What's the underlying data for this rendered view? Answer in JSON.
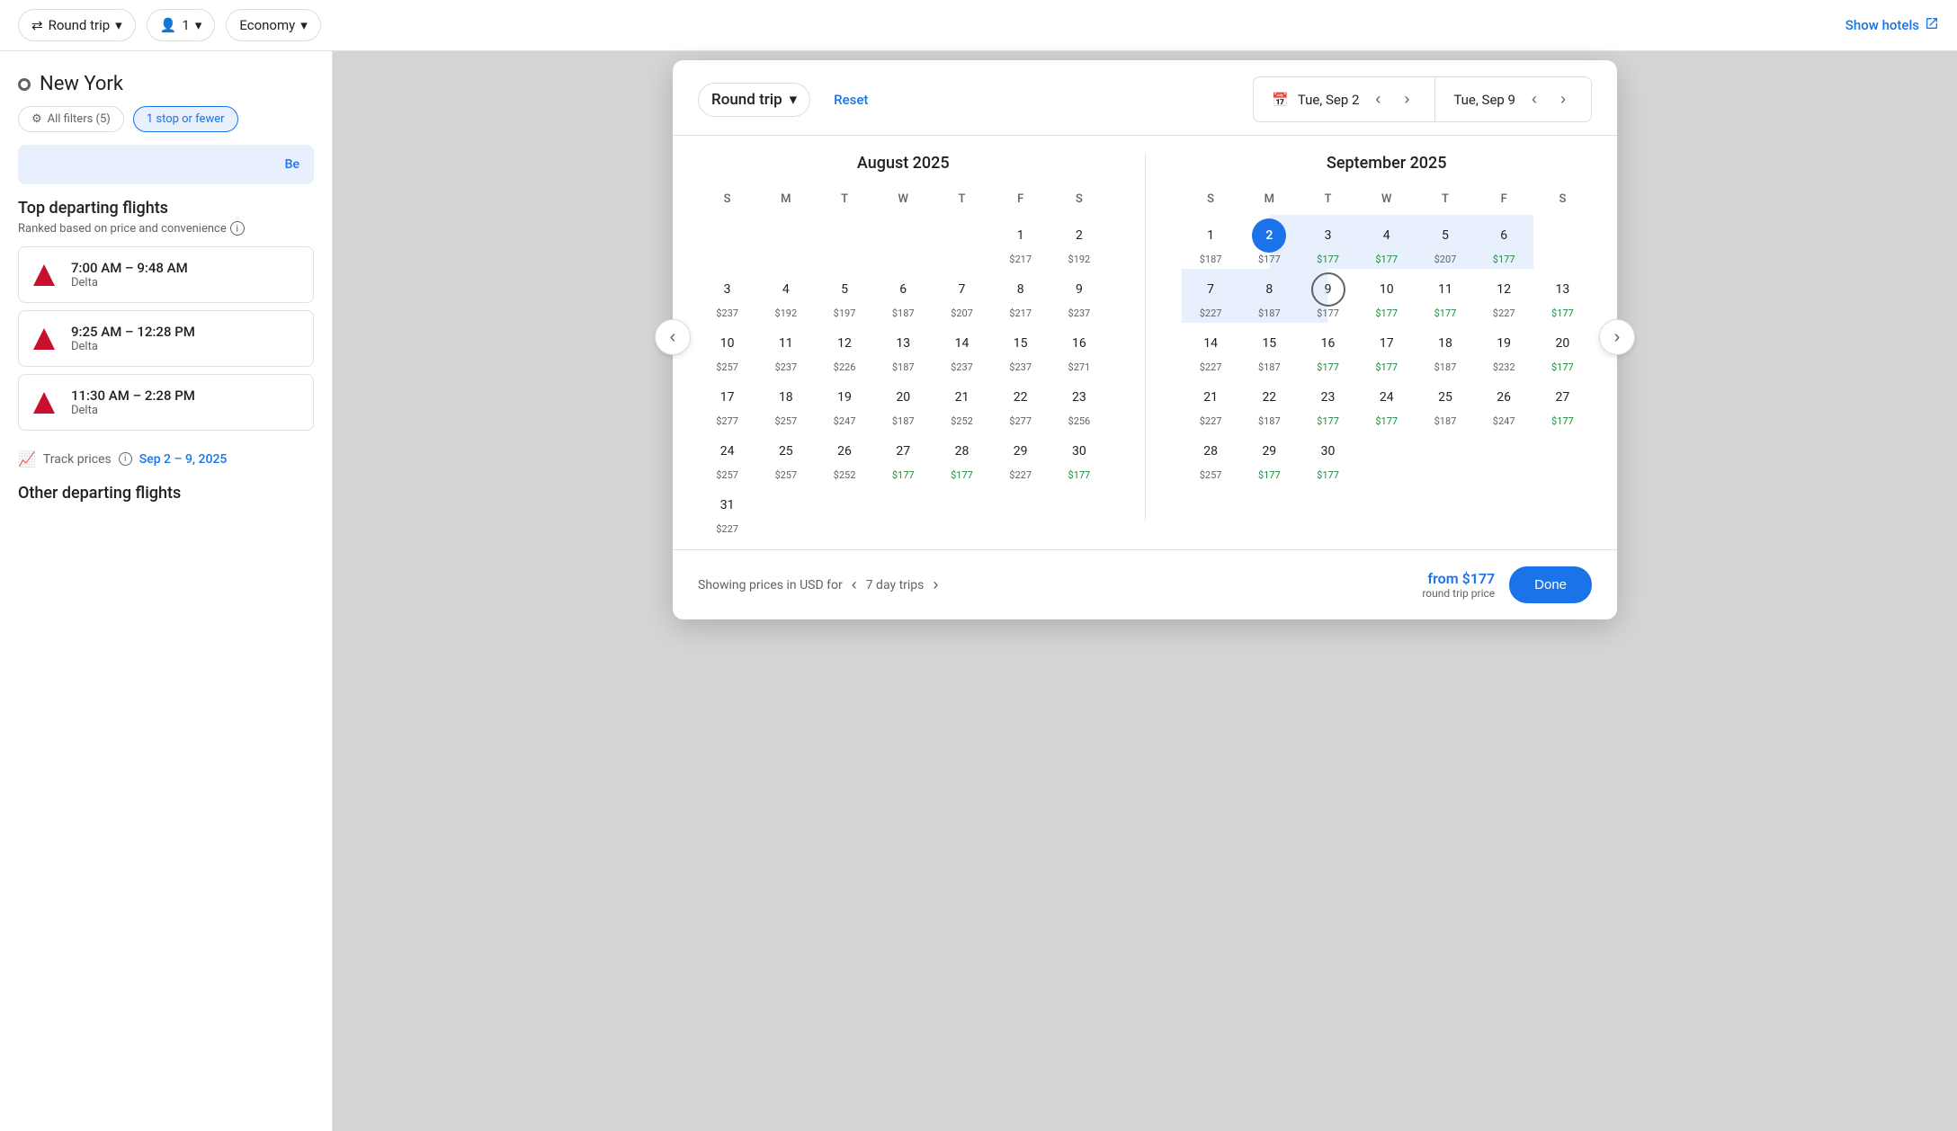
{
  "topBar": {
    "roundTrip": "Round trip",
    "passengers": "1",
    "cabinClass": "Economy",
    "showHotels": "Show hotels"
  },
  "leftPanel": {
    "origin": "New York",
    "filtersLabel": "All filters (5)",
    "stopFilter": "1 stop or fewer",
    "bestLabel": "Be",
    "sectionTitle": "Top departing flights",
    "sectionSub": "Ranked based on price and convenience",
    "flights": [
      {
        "time": "7:00 AM – 9:48 AM",
        "airline": "Delta"
      },
      {
        "time": "9:25 AM – 12:28 PM",
        "airline": "Delta"
      },
      {
        "time": "11:30 AM – 2:28 PM",
        "airline": "Delta"
      }
    ],
    "trackLabel": "Track prices",
    "trackDate": "Sep 2 – 9, 2025",
    "otherFlights": "Other departing flights"
  },
  "calendar": {
    "tripLabel": "Round trip",
    "resetLabel": "Reset",
    "date1": "Tue, Sep 2",
    "date2": "Tue, Sep 9",
    "aug": {
      "title": "August 2025",
      "days": [
        "S",
        "M",
        "T",
        "W",
        "T",
        "F",
        "S"
      ],
      "weeks": [
        [
          null,
          null,
          null,
          null,
          null,
          {
            "d": 1,
            "p": "$217"
          },
          {
            "d": 2,
            "p": "$192"
          }
        ],
        [
          {
            "d": 3,
            "p": "$237"
          },
          {
            "d": 4,
            "p": "$192"
          },
          {
            "d": 5,
            "p": "$197"
          },
          {
            "d": 6,
            "p": "$187"
          },
          {
            "d": 7,
            "p": "$207"
          },
          {
            "d": 8,
            "p": "$217"
          },
          {
            "d": 9,
            "p": "$237"
          }
        ],
        [
          {
            "d": 10,
            "p": "$257"
          },
          {
            "d": 11,
            "p": "$237"
          },
          {
            "d": 12,
            "p": "$226"
          },
          {
            "d": 13,
            "p": "$187"
          },
          {
            "d": 14,
            "p": "$237"
          },
          {
            "d": 15,
            "p": "$237"
          },
          {
            "d": 16,
            "p": "$271"
          }
        ],
        [
          {
            "d": 17,
            "p": "$277"
          },
          {
            "d": 18,
            "p": "$257"
          },
          {
            "d": 19,
            "p": "$247"
          },
          {
            "d": 20,
            "p": "$187"
          },
          {
            "d": 21,
            "p": "$252"
          },
          {
            "d": 22,
            "p": "$277"
          },
          {
            "d": 23,
            "p": "$256"
          }
        ],
        [
          {
            "d": 24,
            "p": "$257"
          },
          {
            "d": 25,
            "p": "$257"
          },
          {
            "d": 26,
            "p": "$252"
          },
          {
            "d": 27,
            "p": "$177",
            "green": true
          },
          {
            "d": 28,
            "p": "$177",
            "green": true
          },
          {
            "d": 29,
            "p": "$227"
          },
          {
            "d": 30,
            "p": "$177",
            "green": true
          }
        ],
        [
          {
            "d": 31,
            "p": "$227"
          },
          null,
          null,
          null,
          null,
          null,
          null
        ]
      ]
    },
    "sep": {
      "title": "September 2025",
      "days": [
        "S",
        "M",
        "T",
        "W",
        "T",
        "F",
        "S"
      ],
      "weeks": [
        [
          {
            "d": 1,
            "p": "$187"
          },
          {
            "d": 2,
            "p": "$177",
            "selected": "start"
          },
          {
            "d": 3,
            "p": "$177",
            "green": true
          },
          {
            "d": 4,
            "p": "$177",
            "green": true
          },
          {
            "d": 5,
            "p": "$207"
          },
          {
            "d": 6,
            "p": "$177",
            "green": true
          },
          null
        ],
        [
          {
            "d": 7,
            "p": "$227"
          },
          {
            "d": 8,
            "p": "$187"
          },
          {
            "d": 9,
            "p": "$177",
            "selected": "end"
          },
          {
            "d": 10,
            "p": "$177",
            "green": true
          },
          {
            "d": 11,
            "p": "$177",
            "green": true
          },
          {
            "d": 12,
            "p": "$227"
          },
          {
            "d": 13,
            "p": "$177",
            "green": true
          }
        ],
        [
          {
            "d": 14,
            "p": "$227"
          },
          {
            "d": 15,
            "p": "$187"
          },
          {
            "d": 16,
            "p": "$177",
            "green": true
          },
          {
            "d": 17,
            "p": "$177",
            "green": true
          },
          {
            "d": 18,
            "p": "$187"
          },
          {
            "d": 19,
            "p": "$232"
          },
          {
            "d": 20,
            "p": "$177",
            "green": true
          }
        ],
        [
          {
            "d": 21,
            "p": "$227"
          },
          {
            "d": 22,
            "p": "$187"
          },
          {
            "d": 23,
            "p": "$177",
            "green": true
          },
          {
            "d": 24,
            "p": "$177",
            "green": true
          },
          {
            "d": 25,
            "p": "$187"
          },
          {
            "d": 26,
            "p": "$247"
          },
          {
            "d": 27,
            "p": "$177",
            "green": true
          }
        ],
        [
          {
            "d": 28,
            "p": "$257"
          },
          {
            "d": 29,
            "p": "$177",
            "green": true
          },
          {
            "d": 30,
            "p": "$177",
            "green": true
          },
          null,
          null,
          null,
          null
        ]
      ]
    },
    "footer": {
      "showing": "Showing prices in USD for",
      "tripDuration": "7 day trips",
      "fromPrice": "from $177",
      "roundTripLabel": "round trip price",
      "doneLabel": "Done"
    }
  }
}
